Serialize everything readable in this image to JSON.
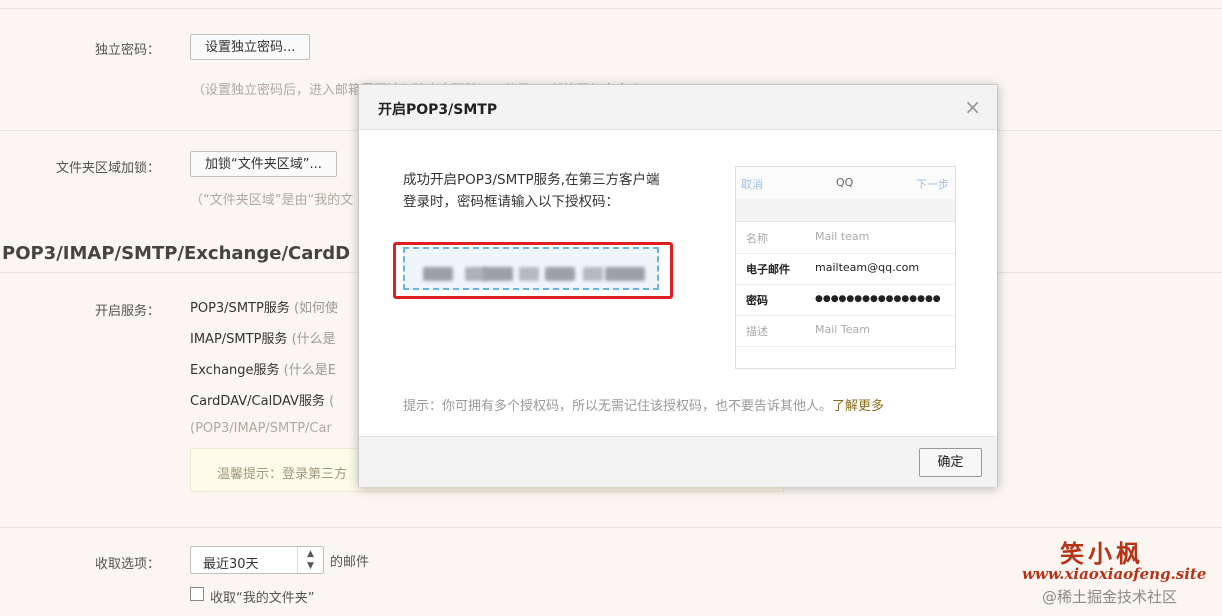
{
  "settings": {
    "independent_password": {
      "label": "独立密码：",
      "button": "设置独立密码...",
      "hint": "（设置独立密码后，进入邮箱需要输入独立密码验证，使用QQ邮箱更加安全。）"
    },
    "folder_lock": {
      "label": "文件夹区域加锁：",
      "button": "加锁“文件夹区域”...",
      "hint": "（“文件夹区域”是由“我的文"
    },
    "section_title": "POP3/IMAP/SMTP/Exchange/CardD",
    "services": {
      "label": "开启服务：",
      "items": [
        {
          "name": "POP3/SMTP服务",
          "q": "(如何使"
        },
        {
          "name": "IMAP/SMTP服务",
          "q": "(什么是"
        },
        {
          "name": "Exchange服务",
          "q": "(什么是E"
        },
        {
          "name": "CardDAV/CalDAV服务",
          "q": "("
        }
      ],
      "note": "(POP3/IMAP/SMTP/Car",
      "warm_tip": "温馨提示：登录第三方"
    },
    "fetch": {
      "label": "收取选项：",
      "select_value": "最近30天",
      "suffix": "的邮件",
      "checkbox_label": "收取“我的文件夹”"
    }
  },
  "dialog": {
    "title": "开启POP3/SMTP",
    "close": "×",
    "message_line1": "成功开启POP3/SMTP服务,在第三方客户端",
    "message_line2": "登录时，密码框请输入以下授权码：",
    "phone": {
      "cancel": "取消",
      "title": "QQ",
      "next": "下一步",
      "rows": [
        {
          "key": "名称",
          "value": "Mail team"
        },
        {
          "key": "电子邮件",
          "value": "mailteam@qq.com"
        },
        {
          "key": "密码",
          "value": "●●●●●●●●●●●●●●●●"
        },
        {
          "key": "描述",
          "value": "Mail Team"
        }
      ]
    },
    "tip": "提示：你可拥有多个授权码，所以无需记住该授权码，也不要告诉其他人。",
    "learn_more": "了解更多",
    "ok": "确定"
  },
  "watermark": {
    "name": "笑小枫",
    "site": "www.xiaoxiaofeng.site",
    "community": "@稀土掘金技术社区"
  }
}
